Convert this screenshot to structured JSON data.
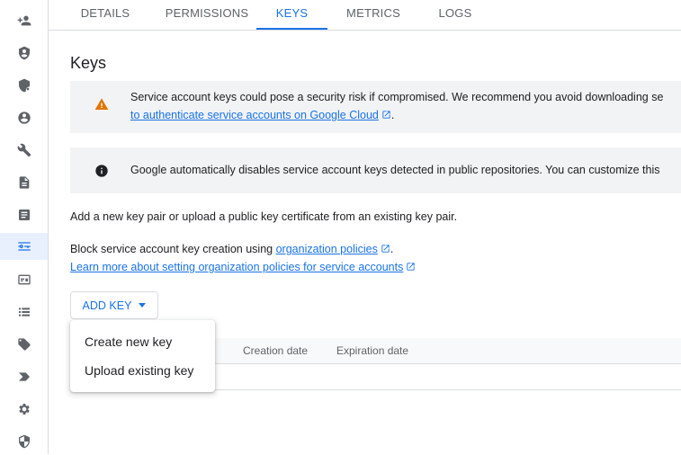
{
  "tabs": [
    "DETAILS",
    "PERMISSIONS",
    "KEYS",
    "METRICS",
    "LOGS"
  ],
  "active_tab": "KEYS",
  "page_title": "Keys",
  "callouts": {
    "warning_line1": "Service account keys could pose a security risk if compromised. We recommend you avoid downloading se",
    "warning_link": "to authenticate service accounts on Google Cloud",
    "warning_after_link": ".",
    "info_text": "Google automatically disables service account keys detected in public repositories. You can customize this"
  },
  "body": {
    "add_key_text": "Add a new key pair or upload a public key certificate from an existing key pair.",
    "block_prefix": "Block service account key creation using ",
    "block_link": "organization policies",
    "block_suffix": ".",
    "learn_more_link": "Learn more about setting organization policies for service accounts"
  },
  "add_key_button": "ADD KEY",
  "dropdown": {
    "items": [
      "Create new key",
      "Upload existing key"
    ]
  },
  "table": {
    "headers": [
      "Creation date",
      "Expiration date"
    ]
  },
  "sidebar": {
    "icons": [
      "person-add-icon",
      "shield-icon",
      "shield-settings-icon",
      "account-circle-icon",
      "wrench-icon",
      "document-icon",
      "article-icon",
      "key-icon",
      "id-card-icon",
      "list-icon",
      "tag-icon",
      "label-arrow-icon",
      "gear-icon",
      "security-icon"
    ],
    "active_index": 7
  },
  "colors": {
    "accent": "#1a73e8",
    "warning": "#e37400",
    "callout_bg": "#f1f3f4"
  }
}
